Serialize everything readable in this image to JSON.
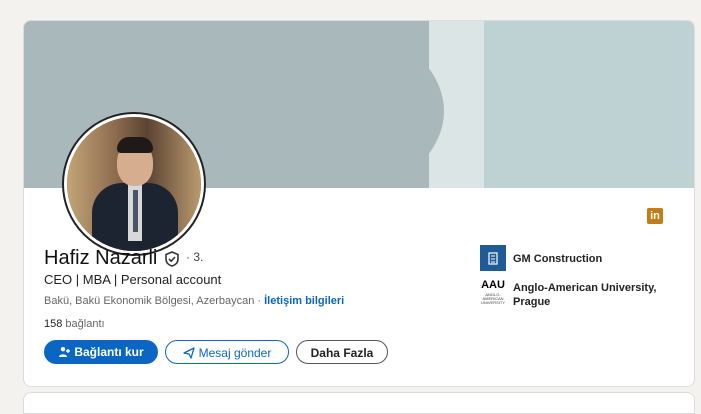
{
  "profile": {
    "name": "Hafiz Nazarli",
    "degree": "· 3.",
    "headline": "CEO | MBA | Personal account",
    "location": "Bakü, Bakü Ekonomik Bölgesi, Azerbaycan",
    "location_sep": " · ",
    "contact_link": "İletişim bilgileri",
    "connections_count": "158",
    "connections_label": "bağlantı"
  },
  "actions": {
    "connect": "Bağlantı kur",
    "message": "Mesaj gönder",
    "more": "Daha Fazla"
  },
  "organizations": [
    {
      "name": "GM Construction"
    },
    {
      "name": "Anglo-American University, Prague",
      "logo_text": "AAU",
      "logo_small": "ANGLO-AMERICAN UNIVERSITY"
    }
  ],
  "linkedin_badge": "in",
  "colors": {
    "accent": "#0a66c2",
    "linkedin_badge": "#c37d16",
    "banner": "#a9b8bb"
  }
}
